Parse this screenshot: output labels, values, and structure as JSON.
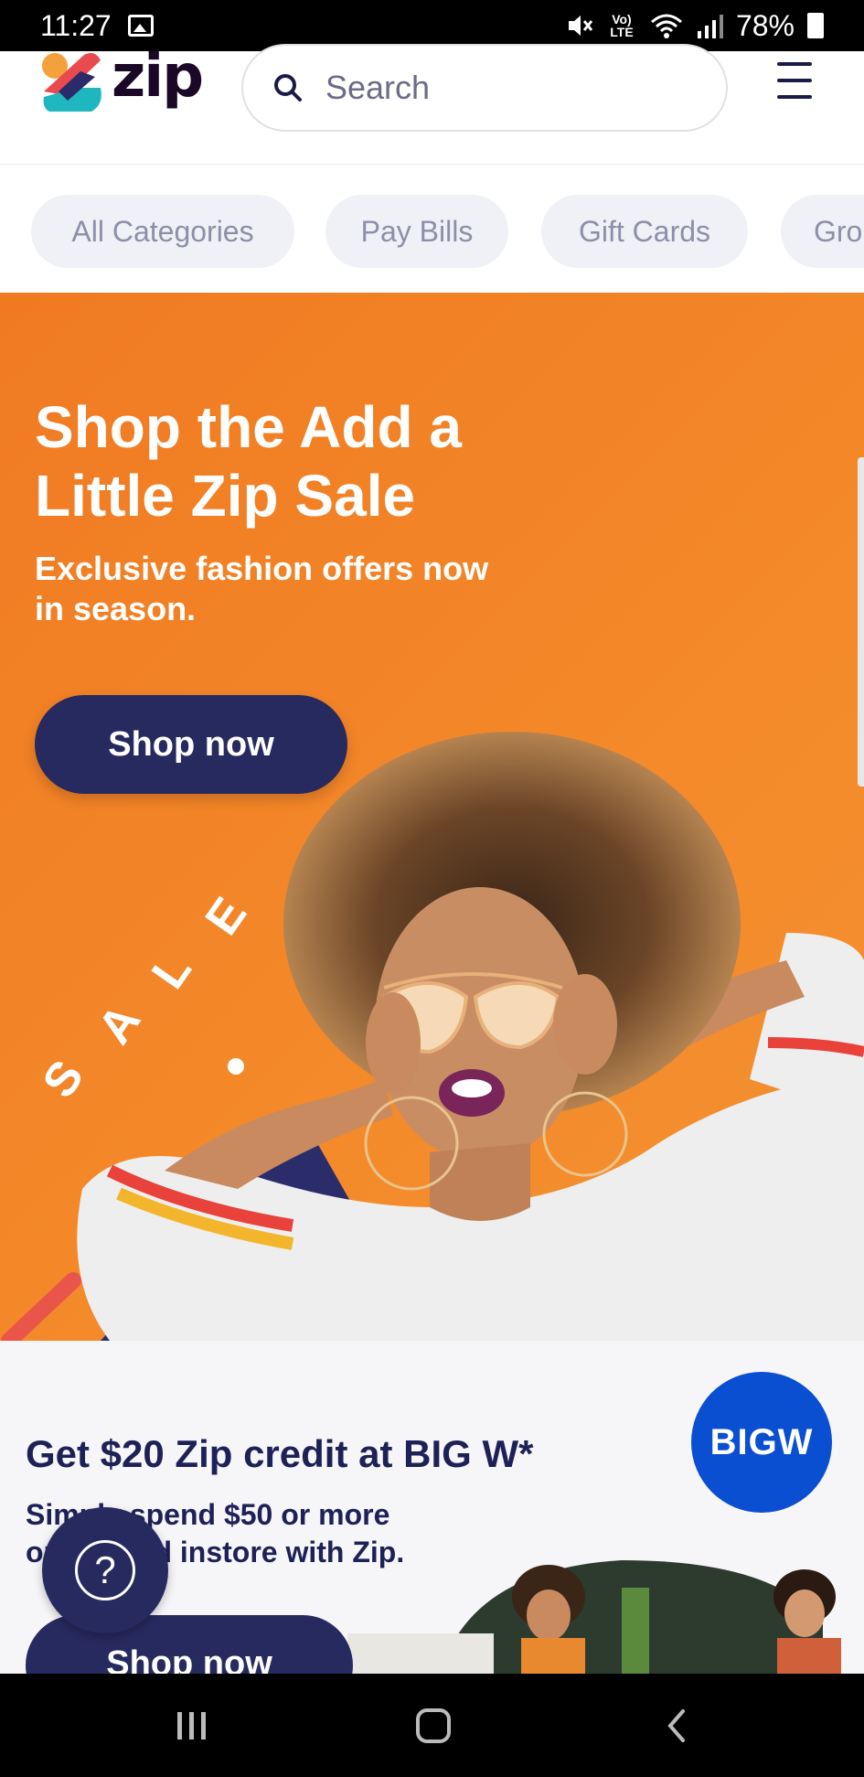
{
  "status_bar": {
    "time": "11:27",
    "network_label": "Vo) LTE",
    "battery": "78%",
    "icons": [
      "image-icon",
      "mute-icon",
      "wifi-icon",
      "signal-icon",
      "battery-icon"
    ]
  },
  "header": {
    "logo_text": "zip",
    "search": {
      "placeholder": "Search",
      "icon": "search-icon"
    },
    "menu_icon": "hamburger-menu-icon"
  },
  "categories": [
    {
      "label": "All Categories"
    },
    {
      "label": "Pay Bills"
    },
    {
      "label": "Gift Cards"
    },
    {
      "label": "Gro"
    }
  ],
  "hero": {
    "title": "Shop the Add a Little Zip Sale",
    "subtitle": "Exclusive fashion offers now in season.",
    "button_label": "Shop now",
    "sale_text": [
      "S",
      "A",
      "L",
      "E"
    ]
  },
  "promo": {
    "badge": "BIGW",
    "title": "Get $20 Zip credit at BIG W*",
    "subtitle_line1": "Simply spend $50 or more",
    "subtitle_line2": "online and instore with Zip.",
    "button_label": "Shop now"
  },
  "help": {
    "label": "?"
  },
  "nav_bar": {
    "items": [
      "recent-apps-icon",
      "home-icon",
      "back-icon"
    ]
  },
  "colors": {
    "hero_orange": "#f07a22",
    "navy": "#272a5f",
    "bigw_blue": "#0a4fd1",
    "chip_bg": "#f0f1f6",
    "chip_text": "#8d8fa8"
  }
}
